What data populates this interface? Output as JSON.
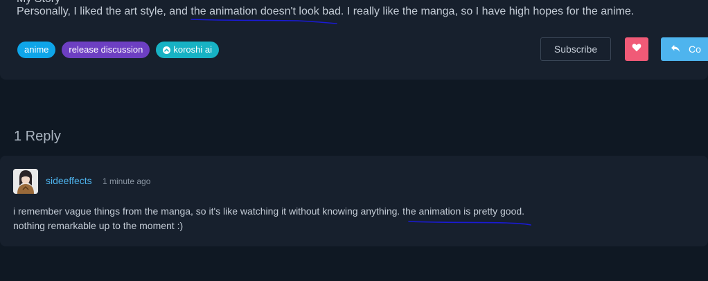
{
  "post": {
    "partial_line": "My Story",
    "text": "Personally, I liked the art style, and the animation doesn't look bad. I really like the manga, so I have high hopes for the anime.",
    "tags": [
      {
        "label": "anime",
        "color": "#0ea5e9",
        "icon": ""
      },
      {
        "label": "release discussion",
        "color": "#6d3fc2",
        "icon": ""
      },
      {
        "label": "koroshi ai",
        "color": "#17b2c4",
        "icon": "chevron-up-circle-icon"
      }
    ],
    "actions": {
      "subscribe_label": "Subscribe",
      "like_icon": "heart-icon",
      "comment_label": "Co",
      "comment_icon": "reply-icon"
    }
  },
  "replies": {
    "count_label": "1 Reply",
    "items": [
      {
        "username": "sideeffects",
        "time": "1 minute ago",
        "line1": "i remember vague things from the manga, so it's like watching it without knowing anything. the animation is pretty good.",
        "line2": "nothing remarkable up to the moment :)"
      }
    ]
  },
  "colors": {
    "page_bg": "#0f1823",
    "card_bg": "#17202d",
    "accent": "#4eb4ee",
    "heart": "#f05a77",
    "annotation": "#1a1ad6"
  }
}
